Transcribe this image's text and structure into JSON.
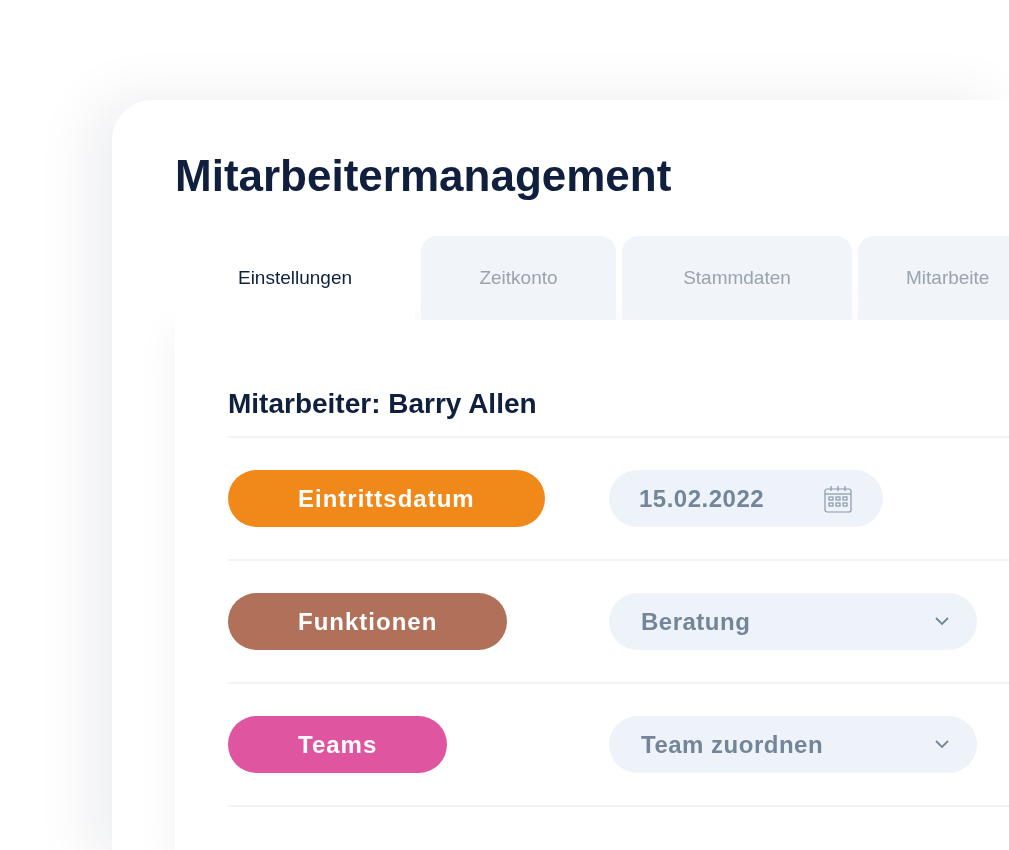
{
  "title": "Mitarbeitermanagement",
  "tabs": [
    {
      "label": "Einstellungen",
      "selected": true
    },
    {
      "label": "Zeitkonto",
      "selected": false
    },
    {
      "label": "Stammdaten",
      "selected": false
    },
    {
      "label": "Mitarbeite",
      "selected": false
    }
  ],
  "employee_heading": "Mitarbeiter: Barry Allen",
  "rows": [
    {
      "label": "Eintrittsdatum",
      "color": "#f0891a",
      "kind": "date",
      "value": "15.02.2022"
    },
    {
      "label": "Funktionen",
      "color": "#b0705a",
      "kind": "select",
      "value": "Beratung"
    },
    {
      "label": "Teams",
      "color": "#e0559f",
      "kind": "select",
      "value": "Team zuordnen"
    }
  ]
}
